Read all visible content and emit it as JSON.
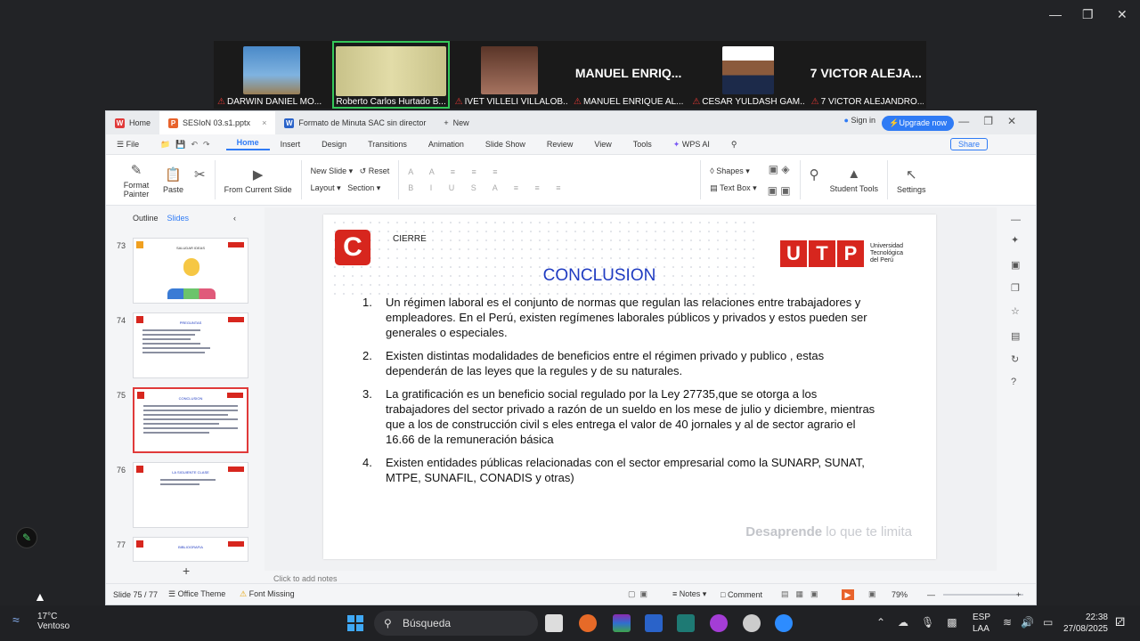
{
  "participants": [
    {
      "name": "DARWIN DANIEL MO...",
      "type": "video",
      "color": "#4a89c8"
    },
    {
      "name": "Roberto Carlos Hurtado B...",
      "type": "video",
      "color": "#c8c289",
      "active": true
    },
    {
      "name": "IVET VILLELI VILLALOB...",
      "type": "video",
      "color": "#7a4a38"
    },
    {
      "name": "MANUEL ENRIQUE AL...",
      "type": "label",
      "label": "MANUEL  ENRIQ..."
    },
    {
      "name": "CESAR YULDASH GAM...",
      "type": "video",
      "color": "#d9d9d9"
    },
    {
      "name": "7 VICTOR ALEJANDRO...",
      "type": "label",
      "label": "7 VICTOR ALEJA..."
    }
  ],
  "tabs": {
    "home": "Home",
    "file1": "SESIoN 03.s1.pptx",
    "file2": "Formato de Minuta SAC sin director",
    "new": "New"
  },
  "account": {
    "signin": "Sign in",
    "upgrade": "Upgrade now"
  },
  "menu": {
    "file": "File",
    "items": [
      "Home",
      "Insert",
      "Design",
      "Transitions",
      "Animation",
      "Slide Show",
      "Review",
      "View",
      "Tools",
      "WPS AI"
    ],
    "share": "Share"
  },
  "ribbon": {
    "format_painter": "Format Painter",
    "paste": "Paste",
    "from_current": "From Current Slide",
    "new_slide": "New Slide",
    "reset": "Reset",
    "layout": "Layout",
    "section": "Section",
    "shapes": "Shapes",
    "text_box": "Text Box",
    "student_tools": "Student Tools",
    "settings": "Settings"
  },
  "leftpane": {
    "outline": "Outline",
    "slides": "Slides",
    "thumbs": [
      {
        "num": "73",
        "title": "SALUDAR IDEAS"
      },
      {
        "num": "74",
        "title": "PREGUNTAS"
      },
      {
        "num": "75",
        "title": "CONCLUSION",
        "selected": true
      },
      {
        "num": "76",
        "title": "LA SIGUIENTE CLASE"
      },
      {
        "num": "77",
        "title": "BIBLIOGRAFIA"
      }
    ]
  },
  "slide": {
    "logo_letter": "C",
    "section": "CIERRE",
    "utp_letters": [
      "U",
      "T",
      "P"
    ],
    "university": [
      "Universidad",
      "Tecnológica",
      "del Perú"
    ],
    "title": "CONCLUSION",
    "items": [
      {
        "n": "1.",
        "text": "Un régimen laboral es el conjunto de normas que regulan las relaciones entre trabajadores y empleadores. En el Perú, existen regímenes laborales públicos y privados y estos pueden ser generales o especiales."
      },
      {
        "n": "2.",
        "text": "Existen distintas modalidades de beneficios entre el régimen privado y publico , estas dependerán de las leyes que la regules y de su naturales."
      },
      {
        "n": "3.",
        "text": "La gratificación es un beneficio social regulado por la Ley 27735,que se otorga a los trabajadores del sector privado a razón de un sueldo en los mese de julio y diciembre, mientras que a los de construcción civil s eles entrega el valor de 40 jornales y al de sector agrario el 16.66 de la remuneración básica"
      },
      {
        "n": "4.",
        "text": "Existen entidades públicas relacionadas con el sector empresarial como la SUNARP, SUNAT, MTPE, SUNAFIL, CONADIS y otras)"
      }
    ],
    "tagline_bold": "Desaprende",
    "tagline_rest": " lo que te limita"
  },
  "notes_placeholder": "Click to add notes",
  "status": {
    "slide": "Slide 75 / 77",
    "theme": "Office Theme",
    "font": "Font Missing",
    "notes": "Notes",
    "comment": "Comment",
    "zoom": "79%"
  },
  "taskbar": {
    "weather_temp": "17°C",
    "weather_desc": "Ventoso",
    "search": "Búsqueda",
    "lang1": "ESP",
    "lang2": "LAA",
    "time": "22:38",
    "date": "27/08/2025"
  }
}
